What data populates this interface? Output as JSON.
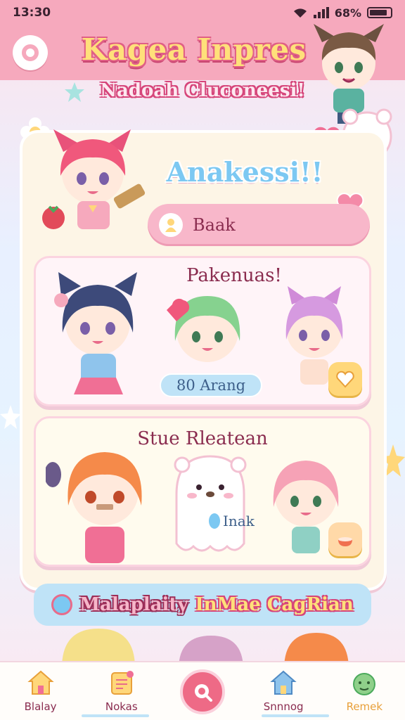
{
  "status": {
    "time": "13:30",
    "battery": "68%"
  },
  "app": {
    "title": "Kagea Inpres",
    "subtitle": "Nadoah Cluconeesi!"
  },
  "section": {
    "title": "Anakessi!!"
  },
  "search": {
    "value": "Baak"
  },
  "cards": [
    {
      "title": "Pakenuas!",
      "badge": "80 Arang"
    },
    {
      "title": "Stue Rleatean",
      "label": "Inak"
    }
  ],
  "banner": {
    "part1": "Malaplaity",
    "part2": "InMae CagRian"
  },
  "nav": {
    "items": [
      {
        "label": "Blalay",
        "icon": "home-icon"
      },
      {
        "label": "Nokas",
        "icon": "notes-icon"
      },
      {
        "label": "",
        "icon": "search-icon"
      },
      {
        "label": "Snnnog",
        "icon": "house-icon"
      },
      {
        "label": "Remek",
        "icon": "face-icon"
      }
    ]
  },
  "colors": {
    "header": "#f6a9bd",
    "accent": "#ee6a86",
    "panel": "#fdf5e6"
  }
}
